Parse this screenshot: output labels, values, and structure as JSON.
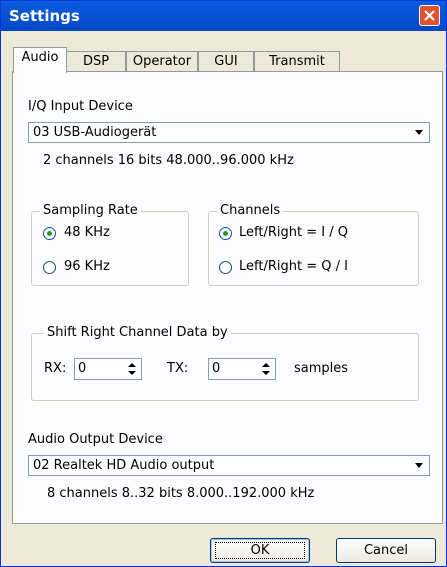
{
  "window": {
    "title": "Settings"
  },
  "tabs": [
    "Audio",
    "DSP",
    "Operator",
    "GUI",
    "Transmit"
  ],
  "iq_input": {
    "label": "I/Q Input Device",
    "selected": "03  USB-Audiogerät",
    "info": "2 channels  16 bits  48.000..96.000 kHz"
  },
  "sampling_rate": {
    "caption": "Sampling Rate",
    "options": [
      "48 KHz",
      "96 KHz"
    ],
    "selected": "48 KHz"
  },
  "channels": {
    "caption": "Channels",
    "options": [
      "Left/Right = I / Q",
      "Left/Right = Q / I"
    ],
    "selected": "Left/Right = I / Q"
  },
  "shift": {
    "caption": "Shift Right Channel Data by",
    "rx_label": "RX:",
    "rx_value": "0",
    "tx_label": "TX:",
    "tx_value": "0",
    "unit": "samples"
  },
  "audio_output": {
    "label": "Audio Output Device",
    "selected": "02  Realtek HD Audio output",
    "info": "8 channels  8..32 bits  8.000..192.000 kHz"
  },
  "buttons": {
    "ok": "OK",
    "cancel": "Cancel"
  },
  "colors": {
    "titlebar": "#0854d8",
    "close_button": "#e0532e",
    "radio_dot": "#21a121"
  }
}
